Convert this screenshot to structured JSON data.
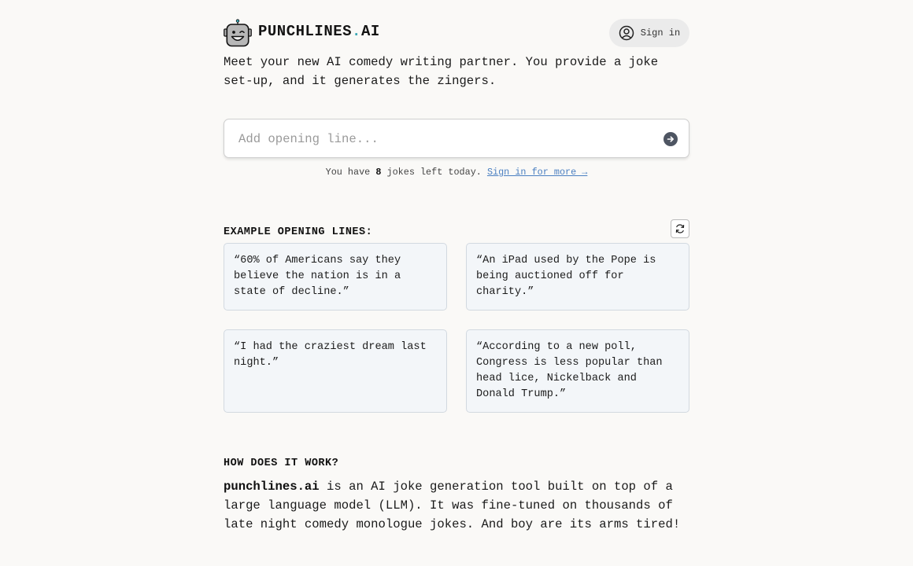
{
  "brand": {
    "name_part1": "PUNCHLINES",
    "dot": ".",
    "name_part2": "AI",
    "logo_icon": "robot-face-icon",
    "accent_color": "#3ba7b5"
  },
  "header": {
    "signin_label": "Sign in",
    "signin_icon": "user-circle-icon"
  },
  "intro": "Meet your new AI comedy writing partner. You provide a joke set-up, and it generates the zingers.",
  "input": {
    "placeholder": "Add opening line...",
    "value": "",
    "submit_icon": "arrow-right-circle-icon"
  },
  "quota": {
    "prefix": "You have ",
    "count": "8",
    "suffix": " jokes left today. ",
    "link": "Sign in for more →"
  },
  "examples": {
    "title": "EXAMPLE OPENING LINES:",
    "refresh_icon": "refresh-icon",
    "items": [
      "“60% of Americans say they believe the nation is in a state of decline.”",
      "“An iPad used by the Pope is being auctioned off for charity.”",
      "“I had the craziest dream last night.”",
      "“According to a new poll, Congress is less popular than head lice, Nickelback and Donald Trump.”"
    ]
  },
  "how": {
    "title": "HOW DOES IT WORK?",
    "brand_bold": "punchlines.ai",
    "text": " is an AI joke generation tool built on top of a large language model (LLM). It was fine-tuned on thousands of late night comedy monologue jokes. And boy are its arms tired!"
  }
}
